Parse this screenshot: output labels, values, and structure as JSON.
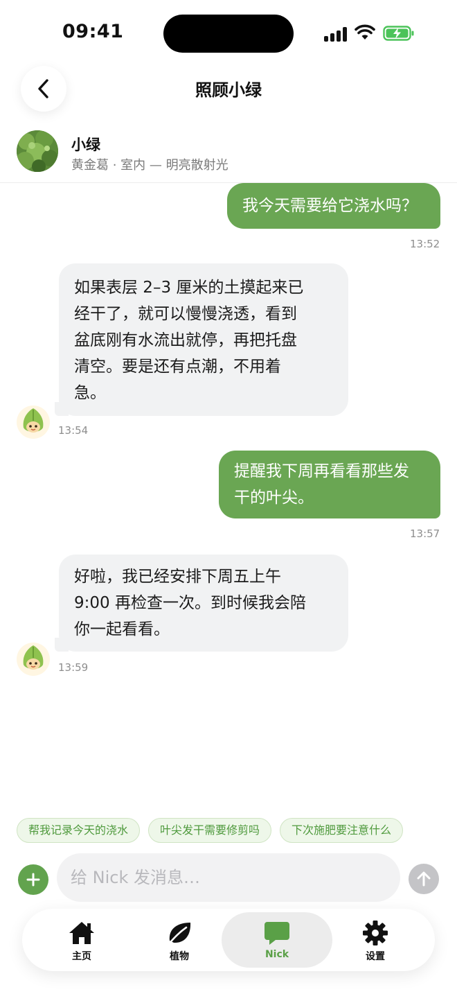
{
  "status": {
    "time": "09:41"
  },
  "header": {
    "title": "照顾小绿"
  },
  "plant": {
    "name": "小绿",
    "subtitle": "黄金葛 · 室内 — 明亮散射光"
  },
  "messages": [
    {
      "role": "user",
      "text": "我今天需要给它浇水吗？",
      "time": "13:52"
    },
    {
      "role": "bot",
      "lines": [
        "如果表层 2–3 厘米的土摸起来已",
        "经干了，就可以慢慢浇透，看到",
        "盆底刚有水流出就停，再把托盘",
        "清空。要是还有点潮，不用着",
        "急。"
      ],
      "time": "13:54"
    },
    {
      "role": "user",
      "lines": [
        "提醒我下周再看看那些发",
        "干的叶尖。"
      ],
      "time": "13:57"
    },
    {
      "role": "bot",
      "lines": [
        "好啦，我已经安排下周五上午",
        "9:00 再检查一次。到时候我会陪",
        "你一起看看。"
      ],
      "time": "13:59"
    }
  ],
  "quick_replies": [
    "帮我记录今天的浇水",
    "叶尖发干需要修剪吗",
    "下次施肥要注意什么"
  ],
  "composer": {
    "placeholder": "给 Nick 发消息…"
  },
  "tabs": [
    {
      "label": "主页",
      "icon": "home-icon"
    },
    {
      "label": "植物",
      "icon": "leaf-icon"
    },
    {
      "label": "Nick",
      "icon": "chat-icon",
      "active": true
    },
    {
      "label": "设置",
      "icon": "gear-icon"
    }
  ],
  "colors": {
    "accent": "#6aa653",
    "bot_bubble": "#f1f2f3",
    "chip_text": "#4f9a3d",
    "active_tab_label": "#5aa047"
  }
}
